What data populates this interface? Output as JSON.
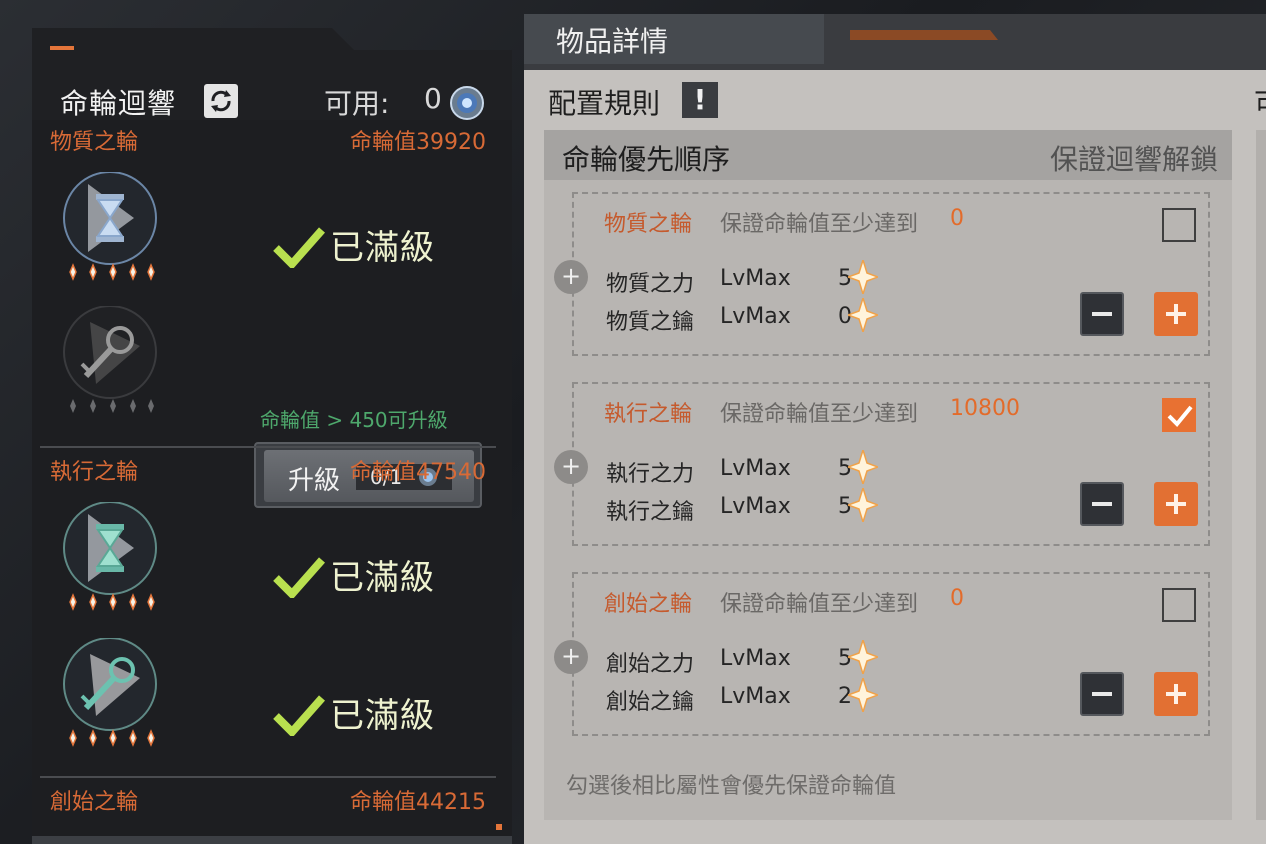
{
  "colors": {
    "accent_orange": "#e27033",
    "wheel_label": "#d86a36",
    "maxed_text": "#eef2cf",
    "check_green": "#b9e04f",
    "hint_green": "#4ea86c"
  },
  "left_panel": {
    "title": "命輪迴響",
    "cycle_icon": "cycle-icon",
    "available_label": "可用:",
    "available_value": "0",
    "wheels": [
      {
        "name": "物質之輪",
        "value": "命輪值39920",
        "items": [
          {
            "icon": "hourglass-icon",
            "stars": 5,
            "filled_stars": 5,
            "status": "已滿級"
          },
          {
            "icon": "key-icon",
            "stars": 5,
            "filled_stars": 0,
            "hint": "命輪值 > 450可升級",
            "button_label": "升級",
            "button_count": "0/1"
          }
        ]
      },
      {
        "name": "執行之輪",
        "value": "命輪值47540",
        "items": [
          {
            "icon": "hourglass-icon",
            "stars": 5,
            "filled_stars": 5,
            "status": "已滿級"
          },
          {
            "icon": "key-icon",
            "stars": 5,
            "filled_stars": 5,
            "status": "已滿級"
          }
        ]
      },
      {
        "name": "創始之輪",
        "value": "命輪值44215"
      }
    ]
  },
  "right_panel": {
    "title": "物品詳情",
    "config_title": "配置規則",
    "warn_icon": "!",
    "edge_char": "可",
    "priority_title": "命輪優先順序",
    "priority_guarantee": "保證迴響解鎖",
    "groups": [
      {
        "name": "物質之輪",
        "guarantee_text": "保證命輪值至少達到",
        "min_value": "0",
        "checked": false,
        "attrs": [
          {
            "name": "物質之力",
            "lv": "LvMax",
            "value": "5"
          },
          {
            "name": "物質之鑰",
            "lv": "LvMax",
            "value": "0"
          }
        ]
      },
      {
        "name": "執行之輪",
        "guarantee_text": "保證命輪值至少達到",
        "min_value": "10800",
        "checked": true,
        "attrs": [
          {
            "name": "執行之力",
            "lv": "LvMax",
            "value": "5"
          },
          {
            "name": "執行之鑰",
            "lv": "LvMax",
            "value": "5"
          }
        ]
      },
      {
        "name": "創始之輪",
        "guarantee_text": "保證命輪值至少達到",
        "min_value": "0",
        "checked": false,
        "attrs": [
          {
            "name": "創始之力",
            "lv": "LvMax",
            "value": "5"
          },
          {
            "name": "創始之鑰",
            "lv": "LvMax",
            "value": "2"
          }
        ]
      }
    ],
    "footer_note": "勾選後相比屬性會優先保證命輪值"
  }
}
